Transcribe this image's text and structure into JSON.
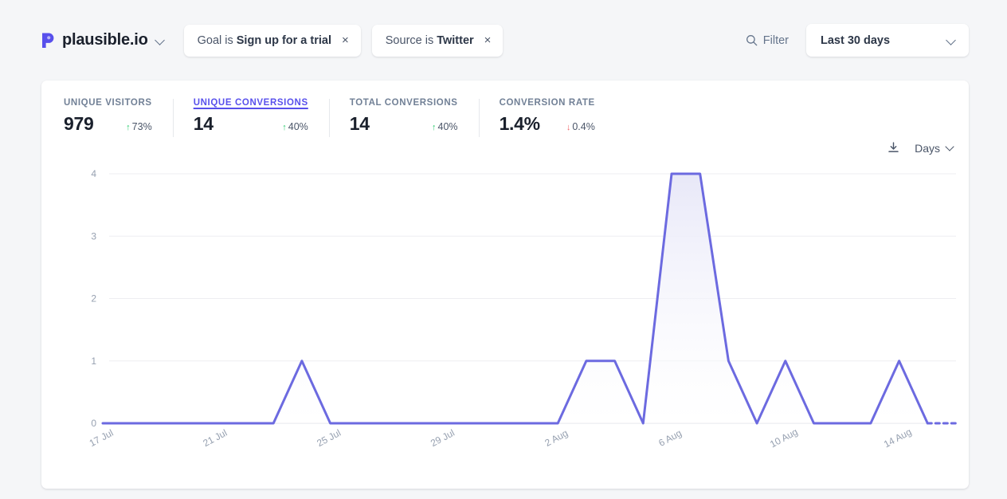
{
  "header": {
    "site_name": "plausible.io",
    "logo_icon": "plausible-logo-icon",
    "site_chevron_icon": "chevron-down-icon",
    "filters": [
      {
        "prefix": "Goal is",
        "value": "Sign up for a trial",
        "remove_icon": "×"
      },
      {
        "prefix": "Source is",
        "value": "Twitter",
        "remove_icon": "×"
      }
    ],
    "filter_button": {
      "label": "Filter",
      "icon": "search-icon"
    },
    "date_range": {
      "label": "Last 30 days",
      "icon": "chevron-down-icon"
    }
  },
  "metrics": [
    {
      "label": "UNIQUE VISITORS",
      "value": "979",
      "change": "73%",
      "direction": "up",
      "arrow": "↑",
      "active": false
    },
    {
      "label": "UNIQUE CONVERSIONS",
      "value": "14",
      "change": "40%",
      "direction": "up",
      "arrow": "↑",
      "active": true
    },
    {
      "label": "TOTAL CONVERSIONS",
      "value": "14",
      "change": "40%",
      "direction": "up",
      "arrow": "↑",
      "active": false
    },
    {
      "label": "CONVERSION RATE",
      "value": "1.4%",
      "change": "0.4%",
      "direction": "down",
      "arrow": "↓",
      "active": false
    }
  ],
  "chart_toolbar": {
    "download_icon": "download-icon",
    "interval_label": "Days",
    "interval_icon": "chevron-down-icon"
  },
  "chart_data": {
    "type": "line",
    "title": "",
    "xlabel": "",
    "ylabel": "",
    "ylim": [
      0,
      4
    ],
    "yticks": [
      0,
      1,
      2,
      3,
      4
    ],
    "grid": true,
    "legend": null,
    "line_color": "#6c6ae0",
    "fill_color": "#e8e8f8",
    "interval": "Days",
    "metric": "Unique conversions",
    "x": [
      "17 Jul",
      "18 Jul",
      "19 Jul",
      "20 Jul",
      "21 Jul",
      "22 Jul",
      "23 Jul",
      "24 Jul",
      "25 Jul",
      "26 Jul",
      "27 Jul",
      "28 Jul",
      "29 Jul",
      "30 Jul",
      "31 Jul",
      "1 Aug",
      "2 Aug",
      "3 Aug",
      "4 Aug",
      "5 Aug",
      "6 Aug",
      "7 Aug",
      "8 Aug",
      "9 Aug",
      "10 Aug",
      "11 Aug",
      "12 Aug",
      "13 Aug",
      "14 Aug",
      "15 Aug",
      "16 Aug"
    ],
    "values": [
      0,
      0,
      0,
      0,
      0,
      0,
      0,
      1,
      0,
      0,
      0,
      0,
      0,
      0,
      0,
      0,
      0,
      1,
      1,
      0,
      4,
      4,
      1,
      0,
      1,
      0,
      0,
      0,
      1,
      0,
      0
    ],
    "xtick_labels": [
      "17 Jul",
      "21 Jul",
      "25 Jul",
      "29 Jul",
      "2 Aug",
      "6 Aug",
      "10 Aug",
      "14 Aug"
    ],
    "xtick_indices": [
      0,
      4,
      8,
      12,
      16,
      20,
      24,
      28
    ],
    "dashed_tail_from_index": 29
  }
}
